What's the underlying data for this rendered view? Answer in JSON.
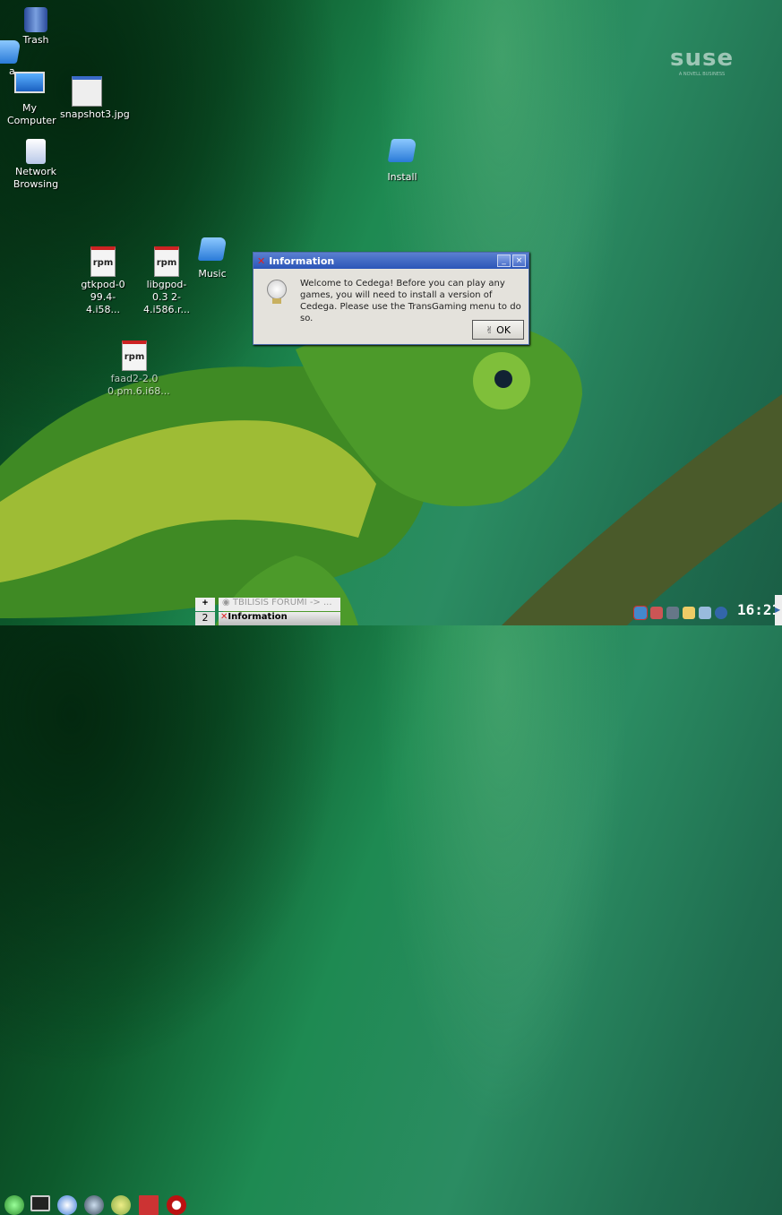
{
  "desktop": {
    "icons": [
      {
        "label": "Trash",
        "icon": "trash-icon"
      },
      {
        "label": "a",
        "icon": "folder-icon"
      },
      {
        "label": "My Computer",
        "icon": "computer-icon"
      },
      {
        "label": "snapshot3.jpg",
        "icon": "image-file-icon"
      },
      {
        "label": "Network Browsing",
        "icon": "network-icon"
      },
      {
        "label": "Install",
        "icon": "folder-icon"
      },
      {
        "label": "gtkpod-0 99.4-4.i58...",
        "icon": "rpm-icon"
      },
      {
        "label": "libgpod-0.3 2-4.i586.r...",
        "icon": "rpm-icon"
      },
      {
        "label": "Music",
        "icon": "folder-icon"
      },
      {
        "label": "faad2-2.0 0.pm.6.i68...",
        "icon": "rpm-icon"
      }
    ],
    "logo": "suse",
    "logo_sub": "A NOVELL BUSINESS"
  },
  "dialog": {
    "title": "Information",
    "message": "Welcome to Cedega! Before you can play any games, you will need to install a version of Cedega. Please use the TransGaming menu to do so.",
    "ok": "OK",
    "minimize": "_",
    "close": "×"
  },
  "taskbar": {
    "pager": [
      "+",
      "2"
    ],
    "tasks": [
      "TBILISIS FORUMI -> ...",
      "Information"
    ],
    "clock": "16:21",
    "colors": {
      "accent": "#2b55b8"
    }
  }
}
